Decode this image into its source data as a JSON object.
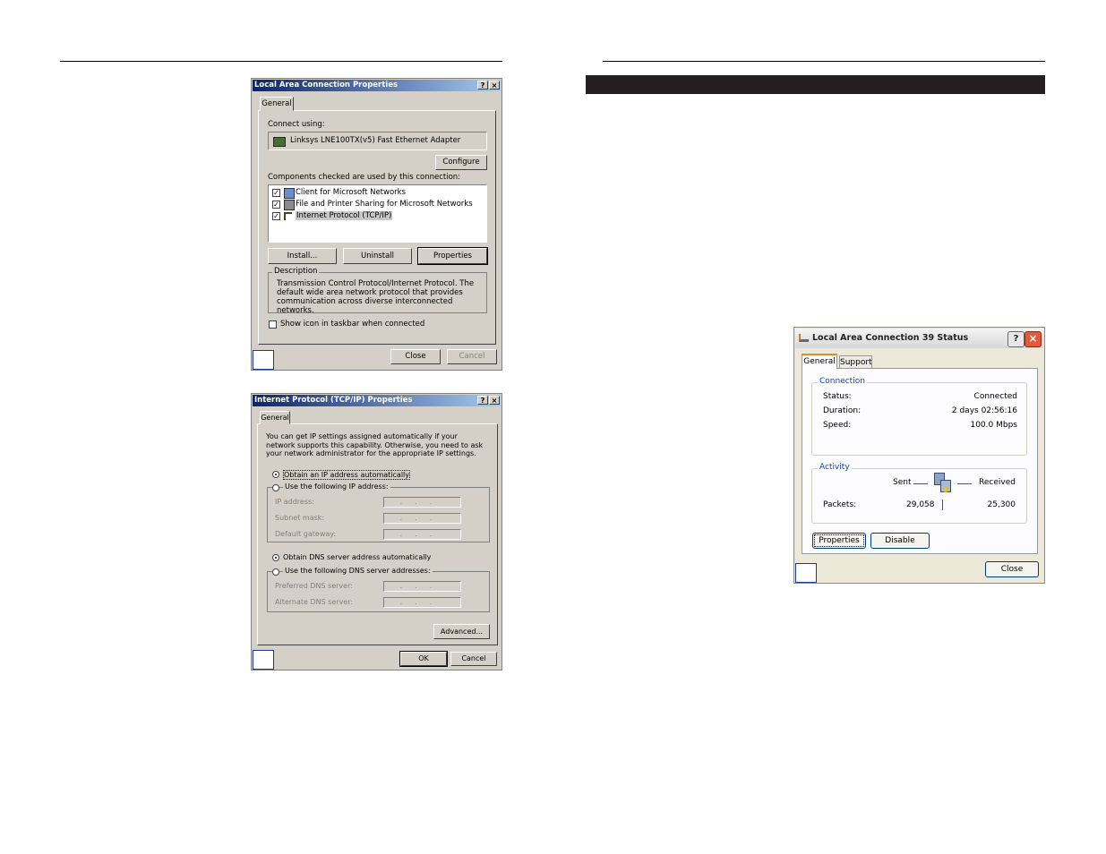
{
  "win1": {
    "title": "Local Area Connection Properties",
    "help": "?",
    "close": "×",
    "tab": "General",
    "connect_using": "Connect using:",
    "adapter": "Linksys LNE100TX(v5) Fast Ethernet Adapter",
    "configure": "Configure",
    "components_label": "Components checked are used by this connection:",
    "components": [
      {
        "label": "Client for Microsoft Networks",
        "checked": "✓",
        "icon": "network-client-icon"
      },
      {
        "label": "File and Printer Sharing for Microsoft Networks",
        "checked": "✓",
        "icon": "printer-share-icon"
      },
      {
        "label": "Internet Protocol (TCP/IP)",
        "checked": "✓",
        "icon": "protocol-icon"
      }
    ],
    "install": "Install...",
    "uninstall": "Uninstall",
    "properties": "Properties",
    "description_title": "Description",
    "description": "Transmission Control Protocol/Internet Protocol. The default wide area network protocol that provides communication across diverse interconnected networks.",
    "show_icon": "Show icon in taskbar when connected",
    "close_btn": "Close",
    "cancel_btn": "Cancel"
  },
  "win2": {
    "title": "Internet Protocol (TCP/IP) Properties",
    "help": "?",
    "close": "×",
    "tab": "General",
    "intro": "You can get IP settings assigned automatically if your network supports this capability. Otherwise, you need to ask your network administrator for the appropriate IP settings.",
    "obtain_ip": "Obtain an IP address automatically",
    "use_ip": "Use the following IP address:",
    "ip_address": "IP address:",
    "subnet_mask": "Subnet mask:",
    "default_gateway": "Default gateway:",
    "obtain_dns": "Obtain DNS server address automatically",
    "use_dns": "Use the following DNS server addresses:",
    "preferred_dns": "Preferred DNS server:",
    "alternate_dns": "Alternate DNS server:",
    "ip_placeholder": "...",
    "advanced": "Advanced...",
    "ok": "OK",
    "cancel": "Cancel"
  },
  "win3": {
    "title": "Local Area Connection 39 Status",
    "help": "?",
    "close": "×",
    "tabs": [
      "General",
      "Support"
    ],
    "connection_title": "Connection",
    "status_label": "Status:",
    "status_value": "Connected",
    "duration_label": "Duration:",
    "duration_value": "2 days 02:56:16",
    "speed_label": "Speed:",
    "speed_value": "100.0 Mbps",
    "activity_title": "Activity",
    "sent": "Sent",
    "received": "Received",
    "packets_label": "Packets:",
    "packets_sent": "29,058",
    "packets_received": "25,300",
    "properties": "Properties",
    "disable": "Disable",
    "close_btn": "Close"
  }
}
